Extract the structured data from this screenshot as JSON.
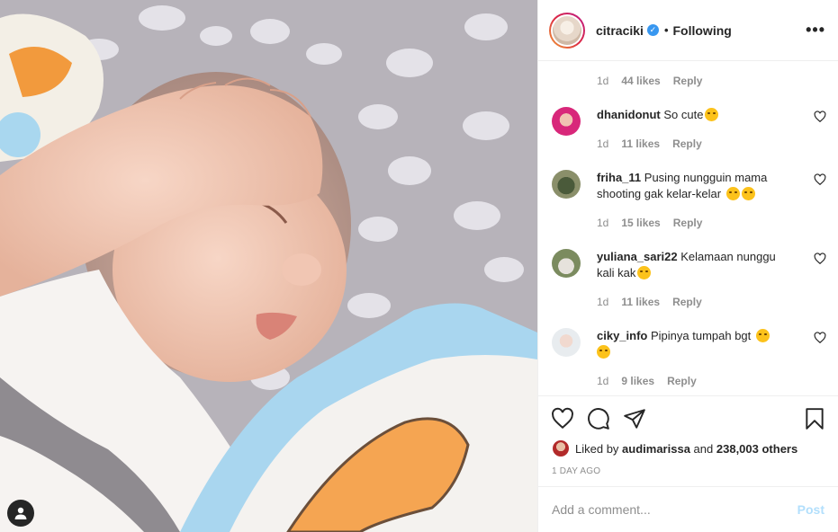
{
  "header": {
    "username": "citraciki",
    "separator": "•",
    "follow_state": "Following",
    "more_label": "•••"
  },
  "comments": {
    "top_meta": {
      "age": "1d",
      "likes": "44 likes",
      "reply": "Reply"
    },
    "items": [
      {
        "username": "dhanidonut",
        "text": "So cute",
        "emojis": [
          "smile"
        ],
        "age": "1d",
        "likes": "11 likes",
        "reply": "Reply"
      },
      {
        "username": "friha_11",
        "text": "Pusing nungguin mama shooting gak kelar-kelar",
        "emojis": [
          "joy",
          "joy"
        ],
        "age": "1d",
        "likes": "15 likes",
        "reply": "Reply"
      },
      {
        "username": "yuliana_sari22",
        "text": "Kelamaan nunggu kali kak",
        "emojis": [
          "joy"
        ],
        "age": "1d",
        "likes": "11 likes",
        "reply": "Reply"
      },
      {
        "username": "ciky_info",
        "text": "Pipinya tumpah bgt",
        "emojis": [
          "star-struck",
          "joy"
        ],
        "age": "1d",
        "likes": "9 likes",
        "reply": "Reply"
      }
    ]
  },
  "engagement": {
    "liked_by_prefix": "Liked by",
    "liked_by_user": "audimarissa",
    "liked_by_suffix": "and",
    "others": "238,003 others",
    "posted_ago": "1 DAY AGO"
  },
  "add_comment": {
    "placeholder": "Add a comment...",
    "post_label": "Post"
  },
  "icons": {
    "like": "heart-icon",
    "comment": "comment-icon",
    "share": "paper-plane-icon",
    "save": "bookmark-icon",
    "tags": "user-tag-icon"
  },
  "colors": {
    "verified": "#3897f0",
    "muted": "#8e8e8e",
    "post_disabled": "#b2dffc",
    "text": "#262626"
  }
}
